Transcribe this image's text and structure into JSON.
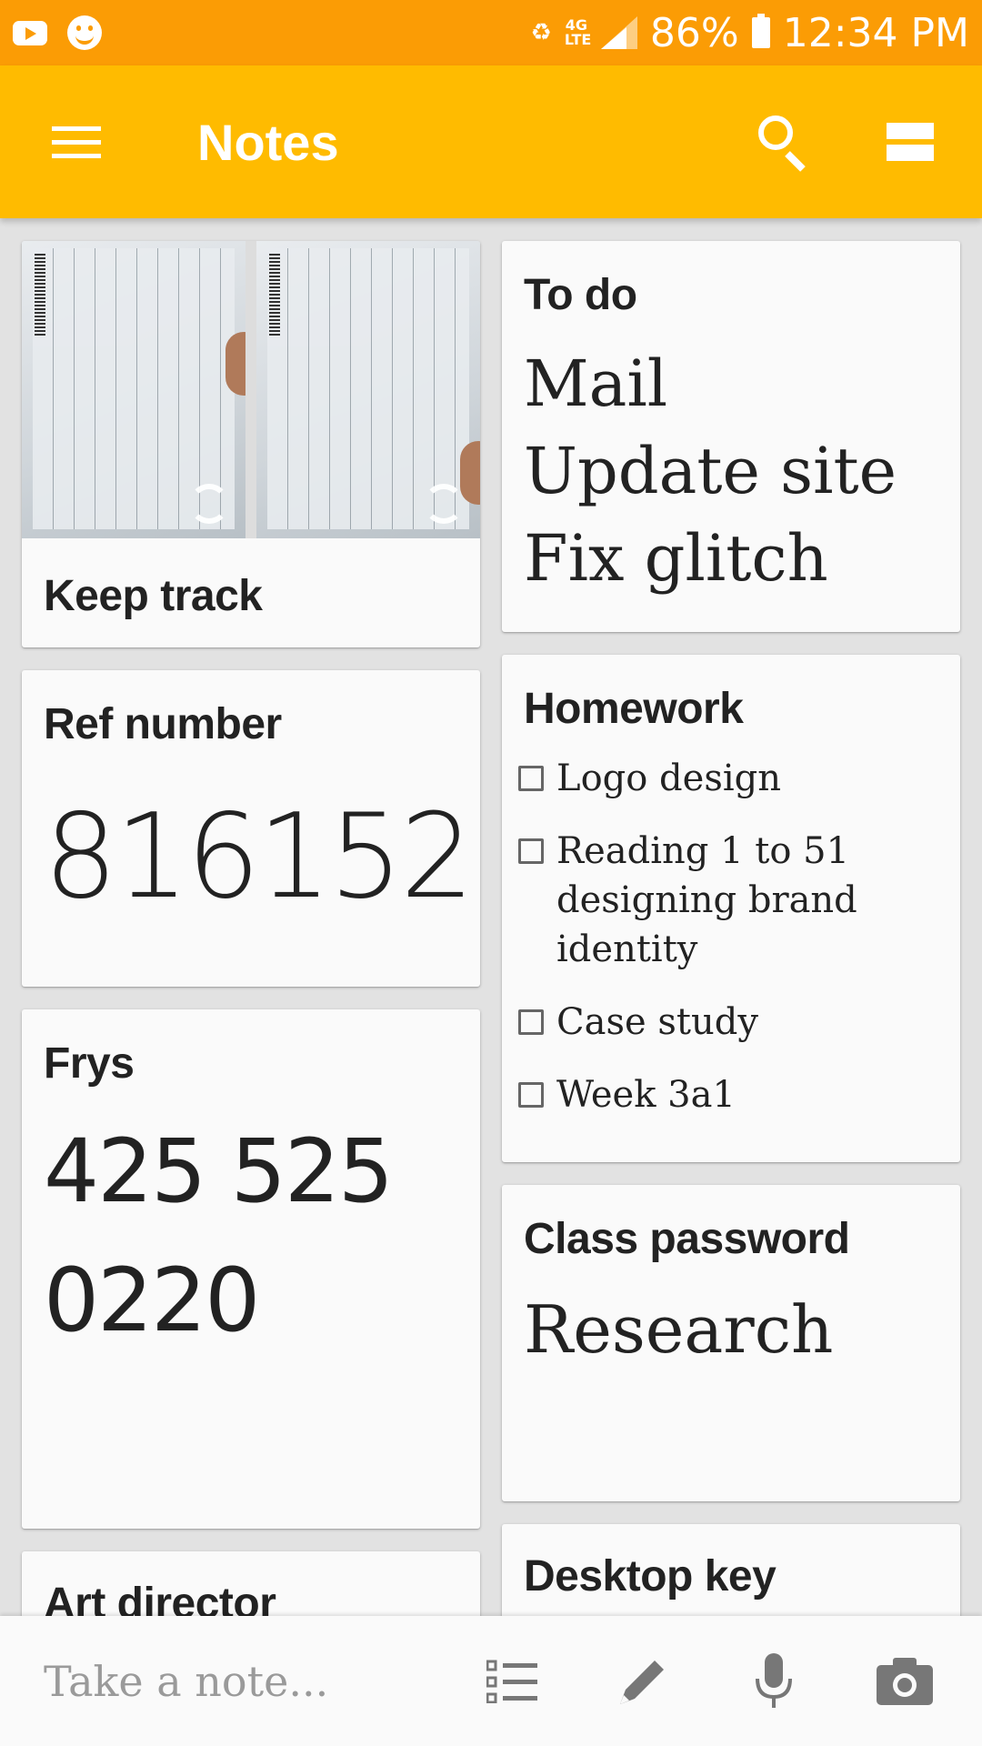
{
  "status_bar": {
    "battery": "86%",
    "time": "12:34 PM",
    "network": "4G LTE"
  },
  "app_bar": {
    "title": "Notes"
  },
  "notes": {
    "keep_track": {
      "title": "Keep track"
    },
    "todo": {
      "title": "To do",
      "lines": [
        "Mail",
        "Update site",
        "Fix glitch"
      ]
    },
    "ref_number": {
      "title": "Ref number",
      "value": "816152"
    },
    "homework": {
      "title": "Homework",
      "items": [
        "Logo design",
        "Reading 1 to 51 designing brand identity",
        "Case study",
        "Week 3a1"
      ]
    },
    "frys": {
      "title": "Frys",
      "line1": "425 525",
      "line2": "0220"
    },
    "class_password": {
      "title": "Class password",
      "value": "Research"
    },
    "art_director": {
      "title": "Art director"
    },
    "desktop_key": {
      "title": "Desktop key"
    }
  },
  "bottom_bar": {
    "placeholder": "Take a note..."
  },
  "colors": {
    "status_bar": "#fb9c05",
    "app_bar": "#ffbb00",
    "card": "#fafafa"
  }
}
